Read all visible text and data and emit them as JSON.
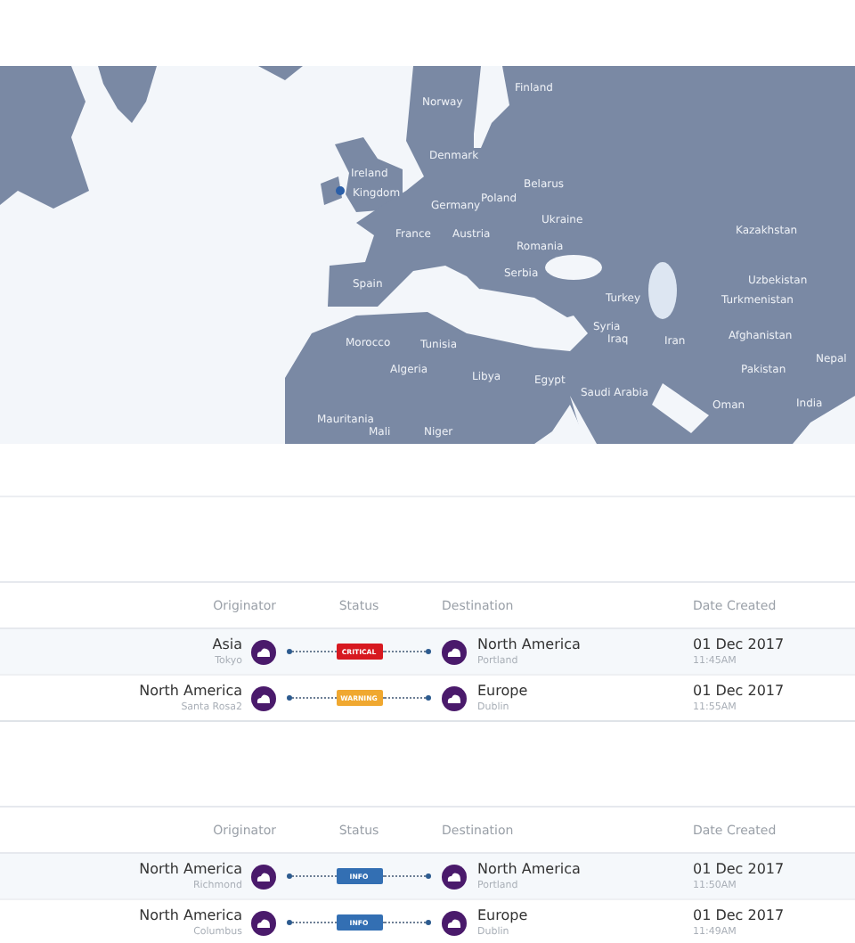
{
  "map": {
    "labels": [
      "Finland",
      "Norway",
      "Ireland",
      "Denmark",
      "Kingdom",
      "Belarus",
      "Germany",
      "Poland",
      "France",
      "Austria",
      "Ukraine",
      "Romania",
      "Kazakhstan",
      "Serbia",
      "Spain",
      "Uzbekistan",
      "Turkmenistan",
      "Turkey",
      "Morocco",
      "Tunisia",
      "Syria",
      "Iraq",
      "Iran",
      "Afghanistan",
      "Algeria",
      "Libya",
      "Egypt",
      "Pakistan",
      "Nepal",
      "Saudi Arabia",
      "Mauritania",
      "Oman",
      "India",
      "Mali",
      "Niger"
    ]
  },
  "tables": [
    {
      "columns": [
        "Originator",
        "Status",
        "Destination",
        "Date Created"
      ],
      "rows": [
        {
          "origin": "Asia",
          "origin_city": "Tokyo",
          "status": "CRITICAL",
          "kind": "critical",
          "destination": "North America",
          "destination_city": "Portland",
          "date": "01 Dec 2017",
          "time": "11:45AM"
        },
        {
          "origin": "North America",
          "origin_city": "Santa Rosa2",
          "status": "WARNING",
          "kind": "warning",
          "destination": "Europe",
          "destination_city": "Dublin",
          "date": "01 Dec 2017",
          "time": "11:55AM"
        }
      ]
    },
    {
      "columns": [
        "Originator",
        "Status",
        "Destination",
        "Date Created"
      ],
      "rows": [
        {
          "origin": "North America",
          "origin_city": "Richmond",
          "status": "INFO",
          "kind": "info",
          "destination": "North America",
          "destination_city": "Portland",
          "date": "01 Dec 2017",
          "time": "11:50AM"
        },
        {
          "origin": "North America",
          "origin_city": "Columbus",
          "status": "INFO",
          "kind": "info",
          "destination": "Europe",
          "destination_city": "Dublin",
          "date": "01 Dec 2017",
          "time": "11:49AM"
        }
      ]
    }
  ]
}
